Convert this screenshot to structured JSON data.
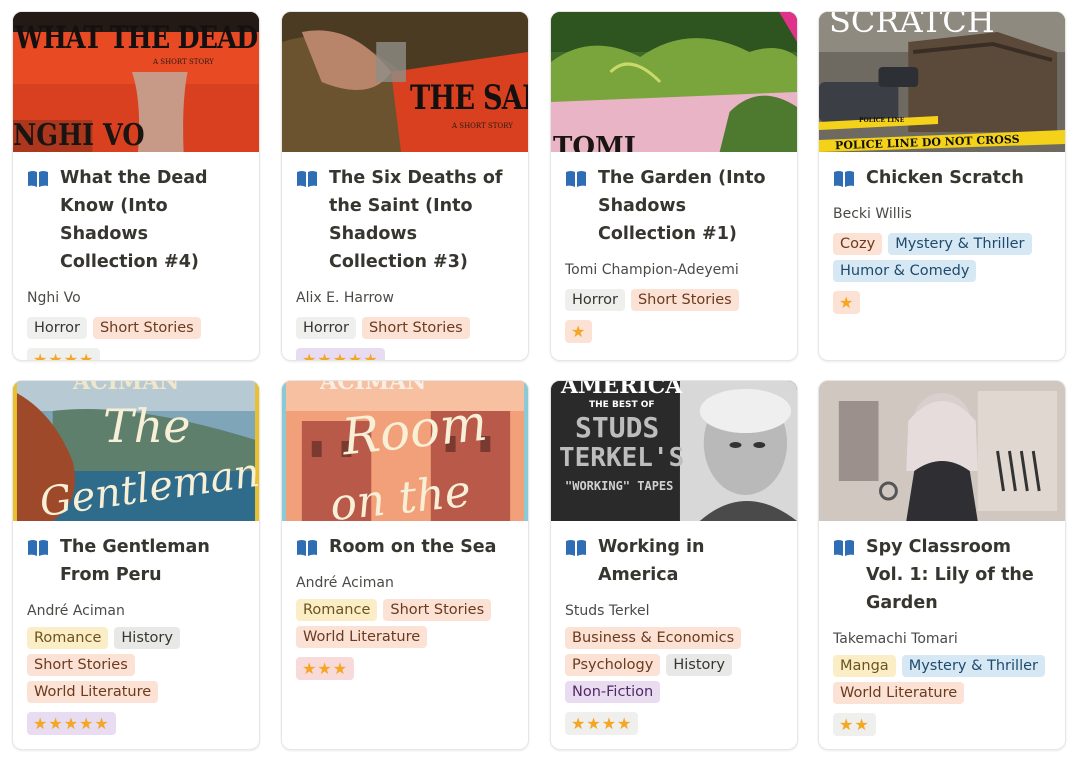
{
  "books": [
    {
      "title": "What the Dead Know (Into Shadows Collection #4)",
      "author": "Nghi Vo",
      "tags": [
        "Horror",
        "Short Stories"
      ],
      "rating": "★★★★",
      "cover_text": {
        "top": "WHAT THE DEAD KNOW",
        "sub": "A SHORT STORY",
        "bottom": "NGHI VO"
      }
    },
    {
      "title": "The Six Deaths of the Saint (Into Shadows Collection #3)",
      "author": "Alix E. Harrow",
      "tags": [
        "Horror",
        "Short Stories"
      ],
      "rating": "★★★★★",
      "cover_text": {
        "main": "THE SAINT",
        "sub": "A SHORT STORY"
      }
    },
    {
      "title": "The Garden (Into Shadows Collection #1)",
      "author": "Tomi Champion-Adeyemi",
      "tags": [
        "Horror",
        "Short Stories"
      ],
      "rating": "★",
      "cover_text": {
        "bottom": "TOMI"
      }
    },
    {
      "title": "Chicken Scratch",
      "author": "Becki Willis",
      "tags": [
        "Cozy",
        "Mystery & Thriller",
        "Humor & Comedy"
      ],
      "rating": "★",
      "cover_text": {
        "top": "SCRATCH",
        "tape1": "POLICE LINE",
        "tape2": "POLICE LINE DO NOT CROSS"
      }
    },
    {
      "title": "The Gentleman From Peru",
      "author": "André Aciman",
      "tags": [
        "Romance",
        "History",
        "Short Stories",
        "World Literature"
      ],
      "rating": "★★★★★",
      "cover_text": {
        "top": "ACIMAN",
        "line1": "The",
        "line2": "Gentleman"
      }
    },
    {
      "title": "Room on the Sea",
      "author": "André Aciman",
      "tags": [
        "Romance",
        "Short Stories",
        "World Literature"
      ],
      "rating": "★★★",
      "cover_text": {
        "top": "ACIMAN",
        "line1": "Room",
        "line2": "on the"
      }
    },
    {
      "title": "Working in America",
      "author": "Studs Terkel",
      "tags": [
        "Business & Economics",
        "Psychology",
        "History",
        "Non-Fiction"
      ],
      "rating": "★★★★",
      "cover_text": {
        "top": "AMERICA",
        "l1": "THE BEST OF",
        "l2": "STUDS",
        "l3": "TERKEL'S",
        "l4": "\"WORKING\" TAPES"
      }
    },
    {
      "title": "Spy Classroom Vol. 1: Lily of the Garden",
      "author": "Takemachi Tomari",
      "tags": [
        "Manga",
        "Mystery & Thriller",
        "World Literature"
      ],
      "rating": "★★",
      "cover_text": {}
    }
  ],
  "colors": {
    "star": "#f5a623",
    "book_icon": "#2f6db5"
  },
  "icons": {
    "book": "book-open-icon"
  }
}
